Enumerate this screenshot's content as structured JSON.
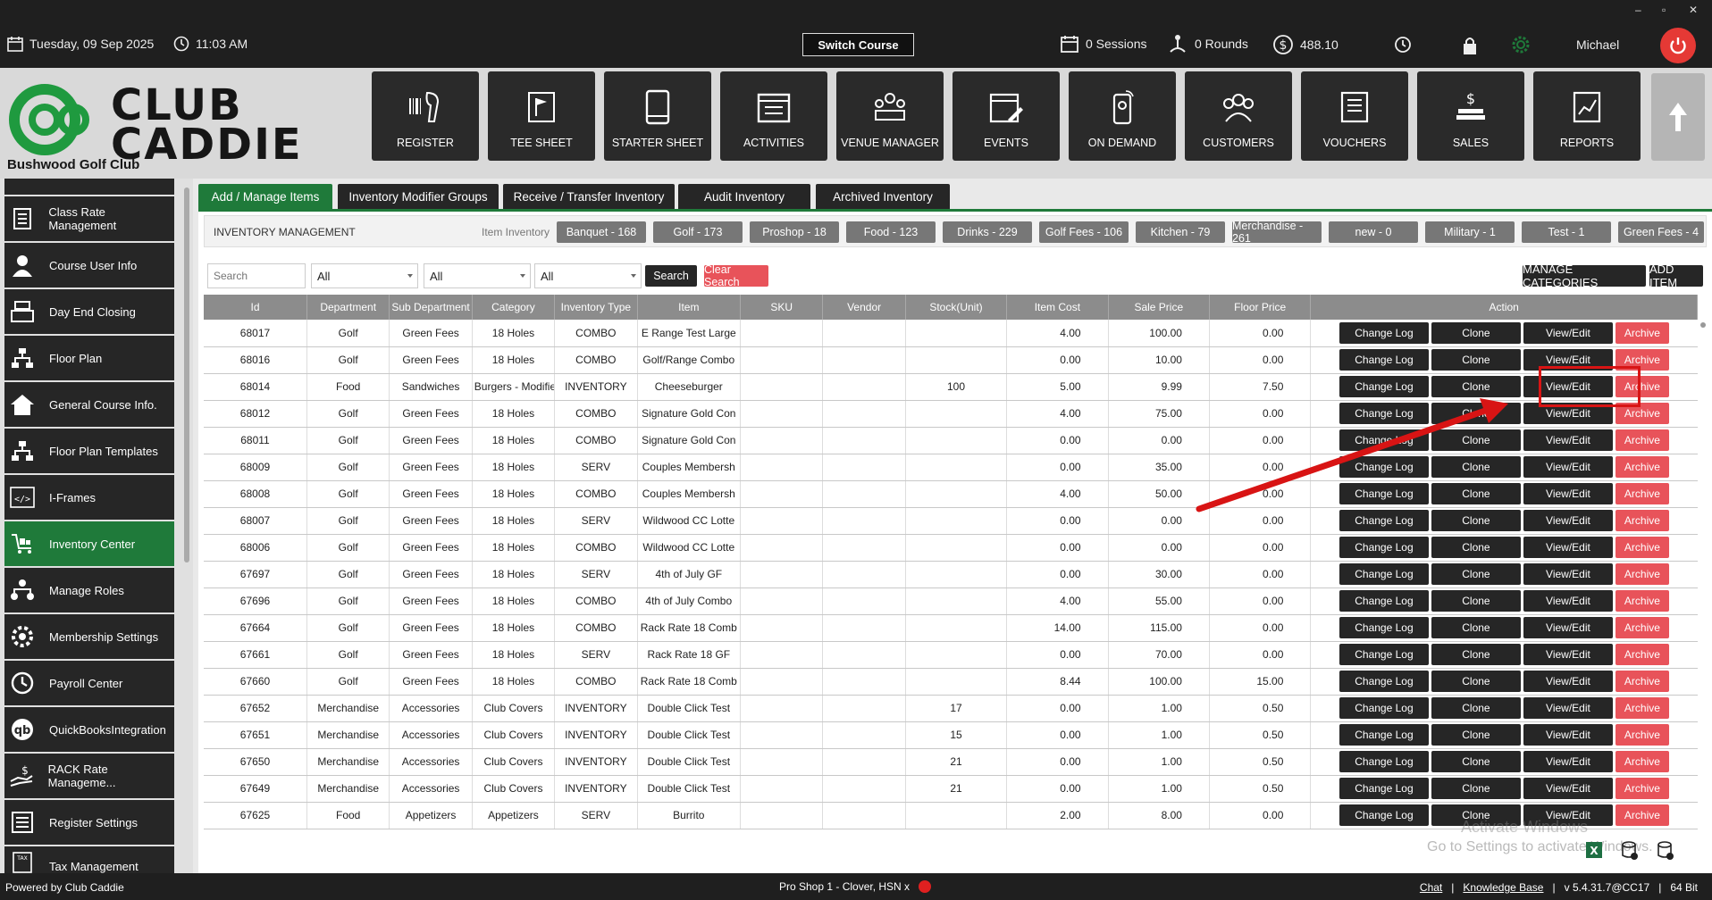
{
  "topbar": {
    "date": "Tuesday,  09 Sep 2025",
    "time": "11:03 AM",
    "switch_course": "Switch Course",
    "sessions": "0 Sessions",
    "rounds": "0 Rounds",
    "balance": "488.10",
    "user": "Michael",
    "window_controls": [
      "–",
      "▫",
      "✕"
    ]
  },
  "brand": {
    "logo_line1": "CLUB",
    "logo_line2": "CADDIE",
    "club_name": "Bushwood Golf Club",
    "accent": "#1f7a3a"
  },
  "nav": [
    {
      "label": "REGISTER",
      "icon": "barcode-scanner-icon"
    },
    {
      "label": "TEE SHEET",
      "icon": "flag-sheet-icon"
    },
    {
      "label": "STARTER SHEET",
      "icon": "tablet-icon"
    },
    {
      "label": "ACTIVITIES",
      "icon": "calendar-list-icon"
    },
    {
      "label": "VENUE MANAGER",
      "icon": "venue-icon"
    },
    {
      "label": "EVENTS",
      "icon": "calendar-edit-icon"
    },
    {
      "label": "ON DEMAND",
      "icon": "mobile-icon"
    },
    {
      "label": "CUSTOMERS",
      "icon": "users-icon"
    },
    {
      "label": "VOUCHERS",
      "icon": "voucher-icon"
    },
    {
      "label": "SALES",
      "icon": "dollar-stack-icon"
    },
    {
      "label": "REPORTS",
      "icon": "report-chart-icon"
    }
  ],
  "sidebar": {
    "items": [
      {
        "label": "Class Rate Management"
      },
      {
        "label": "Course User Info"
      },
      {
        "label": "Day End Closing"
      },
      {
        "label": "Floor Plan"
      },
      {
        "label": "General Course Info."
      },
      {
        "label": "Floor Plan Templates"
      },
      {
        "label": "I-Frames"
      },
      {
        "label": "Inventory Center"
      },
      {
        "label": "Manage Roles"
      },
      {
        "label": "Membership Settings"
      },
      {
        "label": "Payroll Center"
      },
      {
        "label": "QuickBooksIntegration"
      },
      {
        "label": "RACK Rate Manageme..."
      },
      {
        "label": "Register Settings"
      },
      {
        "label": "Tax Management"
      }
    ]
  },
  "tabs": [
    {
      "label": "Add / Manage Items"
    },
    {
      "label": "Inventory Modifier Groups"
    },
    {
      "label": "Receive / Transfer Inventory"
    },
    {
      "label": "Audit Inventory"
    },
    {
      "label": "Archived Inventory"
    }
  ],
  "inventory": {
    "title": "INVENTORY MANAGEMENT",
    "item_inventory_label": "Item Inventory",
    "chips": [
      "Banquet - 168",
      "Golf - 173",
      "Proshop - 18",
      "Food - 123",
      "Drinks - 229",
      "Golf Fees - 106",
      "Kitchen - 79",
      "Merchandise - 261",
      "new - 0",
      "Military - 1",
      "Test - 1",
      "Green Fees - 4"
    ]
  },
  "filters": {
    "search_placeholder": "Search",
    "dept": "All",
    "subdept": "All",
    "category": "All",
    "search_btn": "Search",
    "clear_btn": "Clear Search",
    "manage_categories": "MANAGE CATEGORIES",
    "add_item": "ADD ITEM"
  },
  "table": {
    "headers": [
      "Id",
      "Department",
      "Sub Department",
      "Category",
      "Inventory Type",
      "Item",
      "SKU",
      "Vendor",
      "Stock(Unit)",
      "Item Cost",
      "Sale Price",
      "Floor Price",
      "Action"
    ],
    "actions": {
      "log": "Change Log",
      "clone": "Clone",
      "view": "View/Edit",
      "archive": "Archive"
    },
    "rows": [
      [
        "68017",
        "Golf",
        "Green Fees",
        "18 Holes",
        "COMBO",
        "E Range Test Large",
        "",
        "",
        "",
        "4.00",
        "100.00",
        "0.00"
      ],
      [
        "68016",
        "Golf",
        "Green Fees",
        "18 Holes",
        "COMBO",
        "Golf/Range Combo",
        "",
        "",
        "",
        "0.00",
        "10.00",
        "0.00"
      ],
      [
        "68014",
        "Food",
        "Sandwiches",
        "Burgers - Modifier T",
        "INVENTORY",
        "Cheeseburger",
        "",
        "",
        "100",
        "5.00",
        "9.99",
        "7.50"
      ],
      [
        "68012",
        "Golf",
        "Green Fees",
        "18 Holes",
        "COMBO",
        "Signature Gold Con",
        "",
        "",
        "",
        "4.00",
        "75.00",
        "0.00"
      ],
      [
        "68011",
        "Golf",
        "Green Fees",
        "18 Holes",
        "COMBO",
        "Signature Gold Con",
        "",
        "",
        "",
        "0.00",
        "0.00",
        "0.00"
      ],
      [
        "68009",
        "Golf",
        "Green Fees",
        "18 Holes",
        "SERV",
        "Couples Membersh",
        "",
        "",
        "",
        "0.00",
        "35.00",
        "0.00"
      ],
      [
        "68008",
        "Golf",
        "Green Fees",
        "18 Holes",
        "COMBO",
        "Couples Membersh",
        "",
        "",
        "",
        "4.00",
        "50.00",
        "0.00"
      ],
      [
        "68007",
        "Golf",
        "Green Fees",
        "18 Holes",
        "SERV",
        "Wildwood CC Lotte",
        "",
        "",
        "",
        "0.00",
        "0.00",
        "0.00"
      ],
      [
        "68006",
        "Golf",
        "Green Fees",
        "18 Holes",
        "COMBO",
        "Wildwood CC Lotte",
        "",
        "",
        "",
        "0.00",
        "0.00",
        "0.00"
      ],
      [
        "67697",
        "Golf",
        "Green Fees",
        "18 Holes",
        "SERV",
        "4th of July GF",
        "",
        "",
        "",
        "0.00",
        "30.00",
        "0.00"
      ],
      [
        "67696",
        "Golf",
        "Green Fees",
        "18 Holes",
        "COMBO",
        "4th of July Combo",
        "",
        "",
        "",
        "4.00",
        "55.00",
        "0.00"
      ],
      [
        "67664",
        "Golf",
        "Green Fees",
        "18 Holes",
        "COMBO",
        "Rack Rate 18 Comb",
        "",
        "",
        "",
        "14.00",
        "115.00",
        "0.00"
      ],
      [
        "67661",
        "Golf",
        "Green Fees",
        "18 Holes",
        "SERV",
        "Rack Rate 18 GF",
        "",
        "",
        "",
        "0.00",
        "70.00",
        "0.00"
      ],
      [
        "67660",
        "Golf",
        "Green Fees",
        "18 Holes",
        "COMBO",
        "Rack Rate 18 Comb",
        "",
        "",
        "",
        "8.44",
        "100.00",
        "15.00"
      ],
      [
        "67652",
        "Merchandise",
        "Accessories",
        "Club Covers",
        "INVENTORY",
        "Double Click Test",
        "",
        "",
        "17",
        "0.00",
        "1.00",
        "0.50"
      ],
      [
        "67651",
        "Merchandise",
        "Accessories",
        "Club Covers",
        "INVENTORY",
        "Double Click Test",
        "",
        "",
        "15",
        "0.00",
        "1.00",
        "0.50"
      ],
      [
        "67650",
        "Merchandise",
        "Accessories",
        "Club Covers",
        "INVENTORY",
        "Double Click Test",
        "",
        "",
        "21",
        "0.00",
        "1.00",
        "0.50"
      ],
      [
        "67649",
        "Merchandise",
        "Accessories",
        "Club Covers",
        "INVENTORY",
        "Double Click Test",
        "",
        "",
        "21",
        "0.00",
        "1.00",
        "0.50"
      ],
      [
        "67625",
        "Food",
        "Appetizers",
        "Appetizers",
        "SERV",
        "Burrito",
        "",
        "",
        "",
        "2.00",
        "8.00",
        "0.00"
      ]
    ]
  },
  "watermark": {
    "line1": "Activate Windows",
    "line2": "Go to Settings to activate Windows."
  },
  "footer": {
    "powered": "Powered by Club Caddie",
    "shop": "Pro Shop 1 - Clover, HSN x",
    "chat": "Chat",
    "sep": "|",
    "kb": "Knowledge Base",
    "version": "v 5.4.31.7@CC17",
    "bits": "64 Bit"
  }
}
